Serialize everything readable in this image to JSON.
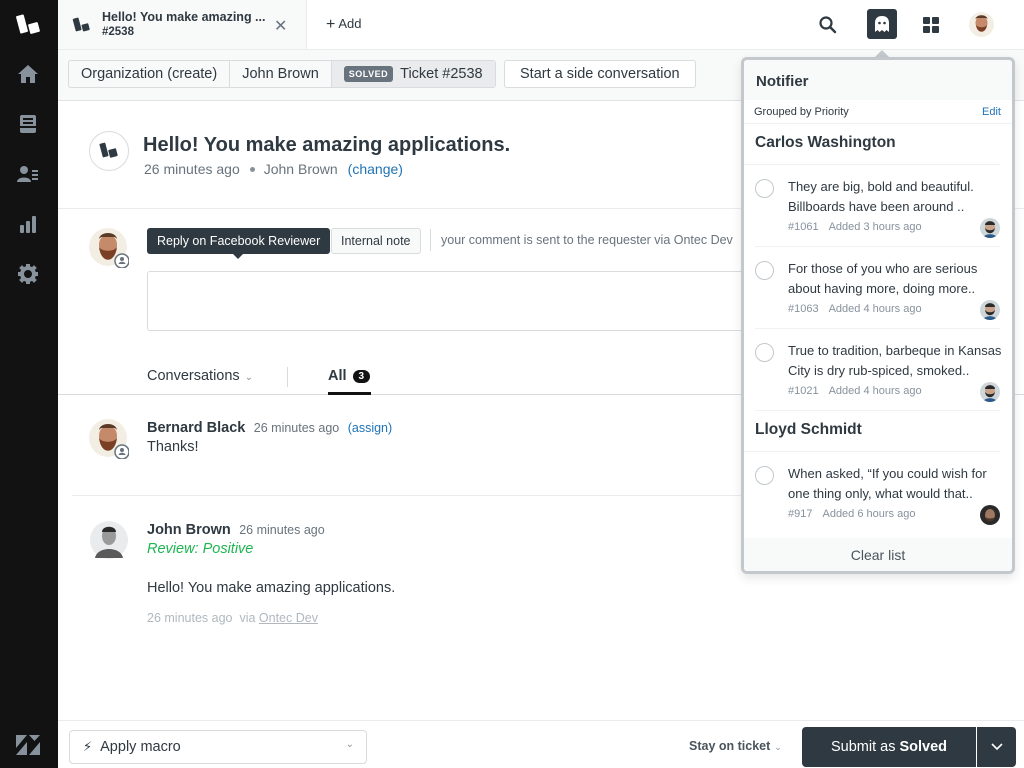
{
  "sidebar": {
    "items": [
      {
        "name": "home",
        "icon": "home-icon"
      },
      {
        "name": "views",
        "icon": "inbox-icon"
      },
      {
        "name": "customers",
        "icon": "customer-list-icon"
      },
      {
        "name": "reporting",
        "icon": "bar-chart-icon"
      },
      {
        "name": "admin",
        "icon": "gear-icon"
      }
    ]
  },
  "topbar": {
    "tab": {
      "title": "Hello! You make amazing ...",
      "subtitle": "#2538"
    },
    "add_label": "Add",
    "add_symbol": "+",
    "close_symbol": "✕"
  },
  "breadcrumbs": {
    "items": [
      "Organization (create)",
      "John Brown"
    ],
    "ticket_status": "SOLVED",
    "ticket_label": "Ticket #2538",
    "side_conversation_label": "Start a side conversation"
  },
  "ticket": {
    "title": "Hello! You make amazing applications.",
    "time": "26 minutes ago",
    "requester": "John Brown",
    "change_label": "(change)"
  },
  "composer": {
    "reply_label": "Reply on Facebook Reviewer",
    "internal_note_label": "Internal note",
    "hint": "your comment is sent to the requester via Ontec Dev"
  },
  "conversation_tabs": {
    "filter_label": "Conversations",
    "all_label": "All",
    "all_count": "3"
  },
  "messages": [
    {
      "author": "Bernard Black",
      "time": "26 minutes ago",
      "assign_label": "(assign)",
      "body": "Thanks!"
    },
    {
      "author": "John Brown",
      "time": "26 minutes ago",
      "review": "Review: Positive",
      "body": "Hello! You make amazing applications.",
      "footer_time": "26 minutes ago",
      "via_prefix": "via",
      "via_channel": "Ontec Dev"
    }
  ],
  "footer": {
    "macro_label": "Apply macro",
    "stay_label": "Stay on ticket",
    "submit_prefix": "Submit as",
    "submit_status": "Solved"
  },
  "notifier": {
    "title": "Notifier",
    "grouping": "Grouped by Priority",
    "edit_label": "Edit",
    "groups": [
      {
        "name": "Carlos Washington",
        "items": [
          {
            "text": "They are big, bold and beautiful. Billboards have been around ..",
            "id": "#1061",
            "added": "Added 3 hours ago"
          },
          {
            "text": "For those of you who are serious about having more, doing more..",
            "id": "#1063",
            "added": "Added 4 hours ago"
          },
          {
            "text": "True to tradition, barbeque in Kansas City is dry rub-spiced, smoked..",
            "id": "#1021",
            "added": "Added 4 hours ago"
          }
        ]
      },
      {
        "name": "Lloyd Schmidt",
        "items": [
          {
            "text": "When asked, “If you could wish for one thing only, what would that..",
            "id": "#917",
            "added": "Added 6 hours ago"
          }
        ]
      }
    ],
    "clear_label": "Clear list"
  },
  "colors": {
    "sidebar_bg": "#121212",
    "primary_dark": "#2f3941",
    "link_blue": "#1f73b7",
    "review_green": "#1db550",
    "solved_badge": "#68737d"
  }
}
